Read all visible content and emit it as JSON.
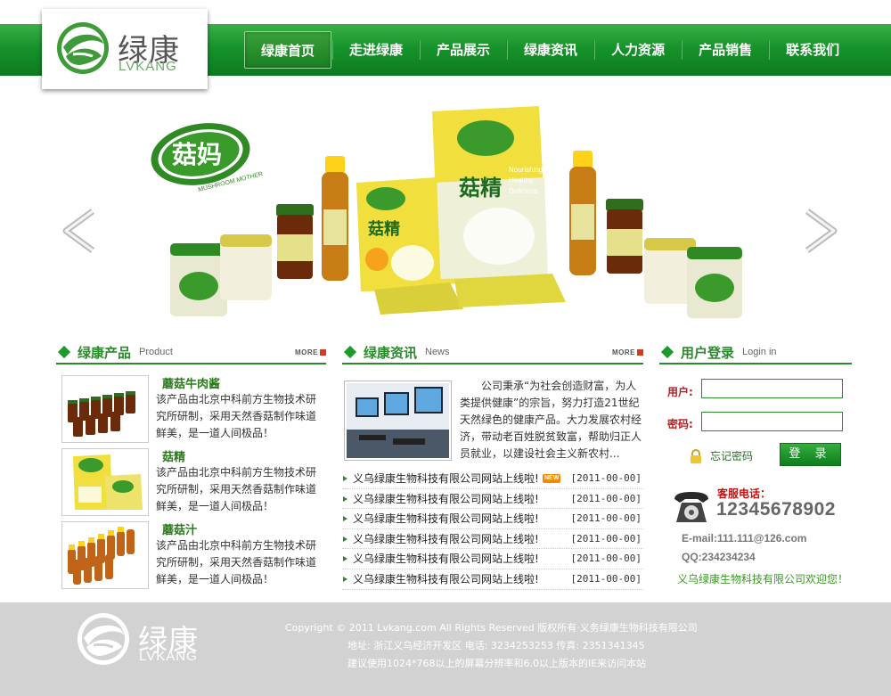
{
  "brand": {
    "name_cn": "绿康",
    "name_en": "LVKANG"
  },
  "nav": {
    "items": [
      "绿康首页",
      "走进绿康",
      "产品展示",
      "绿康资讯",
      "人力资源",
      "产品销售",
      "联系我们"
    ],
    "active_index": 0
  },
  "banner": {
    "brand_logo_text": "菇妈",
    "brand_logo_en": "MUSHROOM MOTHER",
    "package_text": "菇精",
    "package_en": [
      "Nourishing",
      "Healthy",
      "Delicious"
    ]
  },
  "products": {
    "title": "绿康产品",
    "subtitle": "Product",
    "more": "MORE",
    "items": [
      {
        "name": "蘑菇牛肉酱",
        "desc": "该产品由北京中科前方生物技术研究所研制，采用天然香菇制作味道鲜美，是一道人间极品！"
      },
      {
        "name": "菇精",
        "desc": "该产品由北京中科前方生物技术研究所研制，采用天然香菇制作味道鲜美，是一道人间极品！"
      },
      {
        "name": "蘑菇汁",
        "desc": "该产品由北京中科前方生物技术研究所研制，采用天然香菇制作味道鲜美，是一道人间极品！"
      }
    ]
  },
  "news": {
    "title": "绿康资讯",
    "subtitle": "News",
    "more": "MORE",
    "intro": "公司秉承“为社会创造财富，为人类提供健康”的宗旨，努力打造21世纪天然绿色的健康产品。大力发展农村经济，带动老百姓脱贫致富，帮助归正人员就业，以建设社会主义新农村...",
    "new_badge": "NEW",
    "items": [
      {
        "text": "义乌绿康生物科技有限公司网站上线啦!",
        "date": "[2011-00-00]",
        "is_new": true
      },
      {
        "text": "义乌绿康生物科技有限公司网站上线啦!",
        "date": "[2011-00-00]",
        "is_new": false
      },
      {
        "text": "义乌绿康生物科技有限公司网站上线啦!",
        "date": "[2011-00-00]",
        "is_new": false
      },
      {
        "text": "义乌绿康生物科技有限公司网站上线啦!",
        "date": "[2011-00-00]",
        "is_new": false
      },
      {
        "text": "义乌绿康生物科技有限公司网站上线啦!",
        "date": "[2011-00-00]",
        "is_new": false
      },
      {
        "text": "义乌绿康生物科技有限公司网站上线啦!",
        "date": "[2011-00-00]",
        "is_new": false
      }
    ]
  },
  "login": {
    "title": "用户登录",
    "subtitle": "Login in",
    "username_label": "用户:",
    "password_label": "密码:",
    "username_value": "",
    "password_value": "",
    "forgot": "忘记密码",
    "submit": "登 录",
    "service_label": "客服电话：",
    "service_number": "12345678902",
    "email": "E-mail:111.111@126.com",
    "qq": "QQ:234234234",
    "welcome": "义乌绿康生物科技有限公司欢迎您！"
  },
  "footer": {
    "copyright": "Copyright © 2011 Lvkang.com All Rights Reserved 版权所有·义务绿康生物科技有限公司",
    "address": "地址: 浙江义乌经济开发区   电话: 3234253253   传真: 2351341345",
    "notice": "建议使用1024*768以上的屏幕分辨率和6.0以上版本的IE来访问本站"
  },
  "colors": {
    "brand_green": "#17932b",
    "title_green": "#2b8a2b",
    "service_red": "#c81010",
    "footer_gray": "#d2d2d2"
  }
}
